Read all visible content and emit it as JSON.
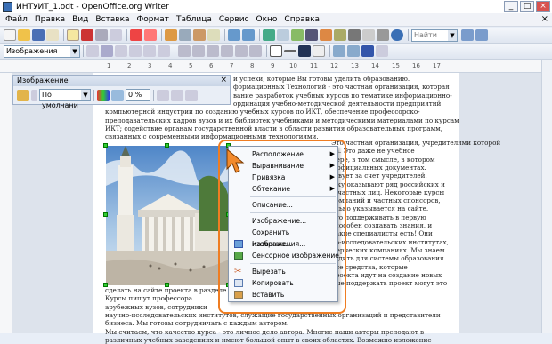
{
  "window": {
    "title": "ИНТУИТ_1.odt - OpenOffice.org Writer",
    "buttons": [
      "_",
      "□",
      "×"
    ]
  },
  "menubar": {
    "items": [
      "Файл",
      "Правка",
      "Вид",
      "Вставка",
      "Формат",
      "Таблица",
      "Сервис",
      "Окно",
      "Справка"
    ],
    "close": "×"
  },
  "toolbar": {
    "search_placeholder": "Найти"
  },
  "formatbar": {
    "style": "Изображения"
  },
  "ruler": {
    "marks": [
      "1",
      "2",
      "3",
      "4",
      "5",
      "6",
      "7",
      "8",
      "9",
      "10",
      "11",
      "12",
      "13",
      "14",
      "15",
      "16",
      "17"
    ]
  },
  "image_panel": {
    "title": "Изображение",
    "filter": "По умолчани",
    "transparency": "0 %"
  },
  "document": {
    "lines_top": [
      "и успехи, которые Вы готовы уделить образованию.",
      "формационных Технологий - это частная организация, которая",
      "вание разработок учебных курсов по тематике информационно-",
      "ординация учебно-методической деятельности предприятий",
      "компьютерной индустрии по созданию учебных курсов по ИКТ, обеспечение профессорско-",
      "преподавательских кадров вузов и их библиотек учебниками и методическими материалами по курсам",
      "ИКТ; содействие органам государственной власти в области развития образовательных программ,",
      "связанных с современными информационными технологиями."
    ],
    "lines_right": [
      "Это частная организация, учредителями которой",
      "ца. Это даже не учебное",
      "мере, в том смысле, в котором",
      "в официальных документах.",
      "ствует за счет учредителей.",
      "ожу оказывают ряд российских и",
      "и частных лиц. Некоторые курсы",
      "компаний и частных спонсоров,",
      "ально указывается на сайте.",
      "что поддерживать в первую",
      "способен создавать знания, и",
      "Такие специалисты есть! Они",
      "но-исследовательских институтах,",
      "мерческих компаниях. Мы знаем",
      "ходить для системы образования",
      "Все средства, которые",
      "проекта идут на создание новых",
      "ные поддержать проект могут это"
    ],
    "lines_bottom": [
      "сделать на сайте проекта в разделе \"",
      "Курсы пишут профессора",
      "арубежных вузов, сотрудники",
      "научно-исследовательских институтов, служащие государственных организаций и представители",
      "бизнеса. Мы готовы сотрудничать с каждым автором.",
      "Мы считаем, что качество курса - это личное дело автора. Многие наши авторы преподают в",
      "различных учебных заведениях и имеют большой опыт в своих областях. Возможно изложение"
    ]
  },
  "context_menu": {
    "items": [
      {
        "label": "Расположение",
        "icon": "",
        "submenu": true
      },
      {
        "label": "Выравнивание",
        "icon": "",
        "submenu": true
      },
      {
        "label": "Привязка",
        "icon": "",
        "submenu": true
      },
      {
        "label": "Обтекание",
        "icon": "",
        "submenu": true
      },
      {
        "label": "Описание...",
        "icon": "",
        "submenu": false
      },
      {
        "label": "Изображение...",
        "icon": "",
        "submenu": false
      },
      {
        "label": "Сохранить изображения...",
        "icon": "",
        "submenu": false
      },
      {
        "label": "Название...",
        "icon": "caption-icon",
        "submenu": false
      },
      {
        "label": "Сенсорное изображение",
        "icon": "imagemap-icon",
        "submenu": false
      },
      {
        "label": "Вырезать",
        "icon": "scissors-icon",
        "submenu": false
      },
      {
        "label": "Копировать",
        "icon": "copy-icon",
        "submenu": false
      },
      {
        "label": "Вставить",
        "icon": "paste-icon",
        "submenu": false
      }
    ]
  },
  "colors": {
    "accent": "#ef7d22",
    "handle": "#33cc33"
  }
}
